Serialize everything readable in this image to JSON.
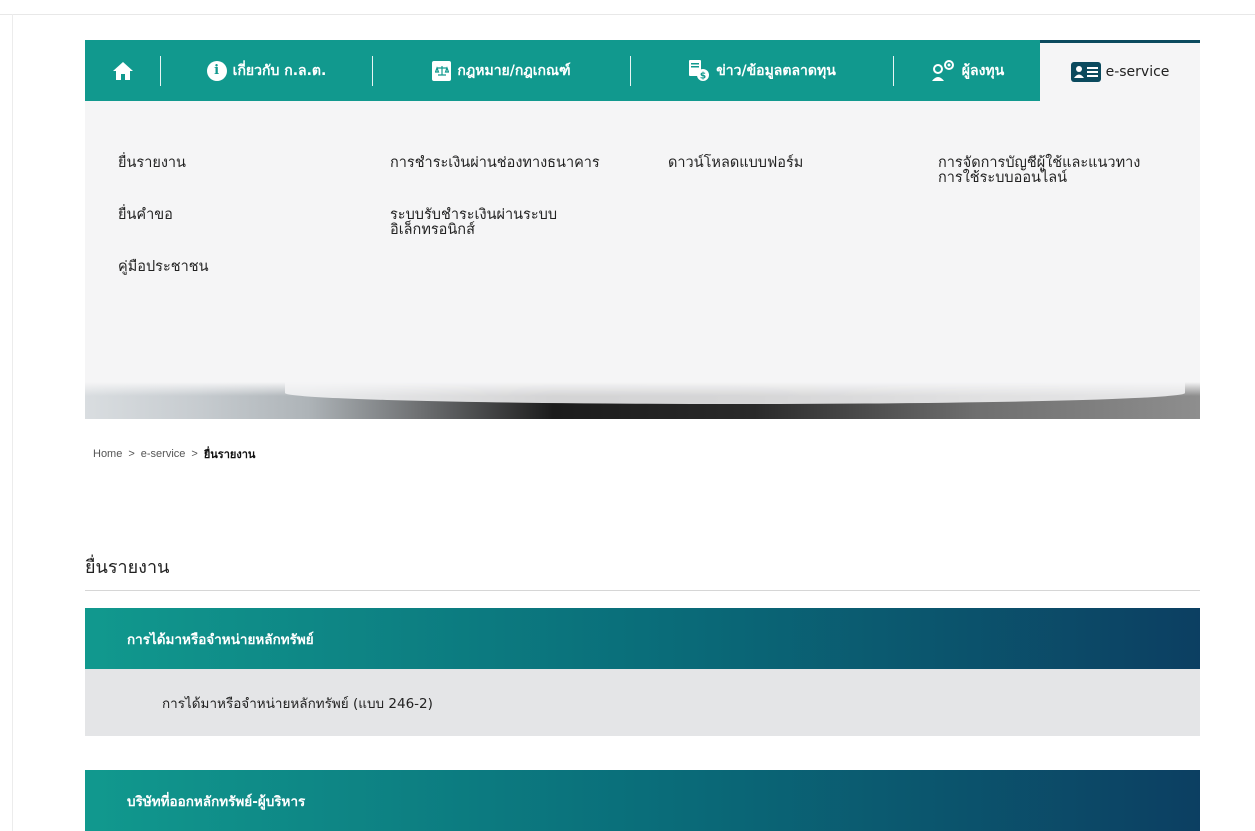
{
  "nav": {
    "about": "เกี่ยวกับ ก.ล.ต.",
    "law": "กฎหมาย/กฎเกณฑ์",
    "news": "ข่าว/ข้อมูลตลาดทุน",
    "investor": "ผู้ลงทุน",
    "eservice": "e-service"
  },
  "menu": {
    "col1": [
      "ยื่นรายงาน",
      "ยื่นคำขอ",
      "คู่มือประชาชน"
    ],
    "col2_item1": "การชำระเงินผ่านช่องทางธนาคาร",
    "col2_item2_line1": "ระบบรับชำระเงินผ่านระบบ",
    "col2_item2_line2": "อิเล็กทรอนิกส์",
    "col3_item1": "ดาวน์โหลดแบบฟอร์ม",
    "col4_item1_line1": "การจัดการบัญชีผู้ใช้และแนวทาง",
    "col4_item1_line2": "การใช้ระบบออนไลน์"
  },
  "breadcrumb": {
    "home": "Home",
    "sep": ">",
    "eservice": "e-service",
    "current": "ยื่นรายงาน"
  },
  "page": {
    "title": "ยื่นรายงาน"
  },
  "sections": [
    {
      "header": "การได้มาหรือจำหน่ายหลักทรัพย์",
      "item": "การได้มาหรือจำหน่ายหลักทรัพย์ (แบบ 246-2)"
    },
    {
      "header": "บริษัทที่ออกหลักทรัพย์-ผู้บริหาร"
    }
  ],
  "colors": {
    "nav_green": "#11998e",
    "header_gradient_end": "#0c3f62",
    "dropdown_bg": "#f5f5f6"
  }
}
